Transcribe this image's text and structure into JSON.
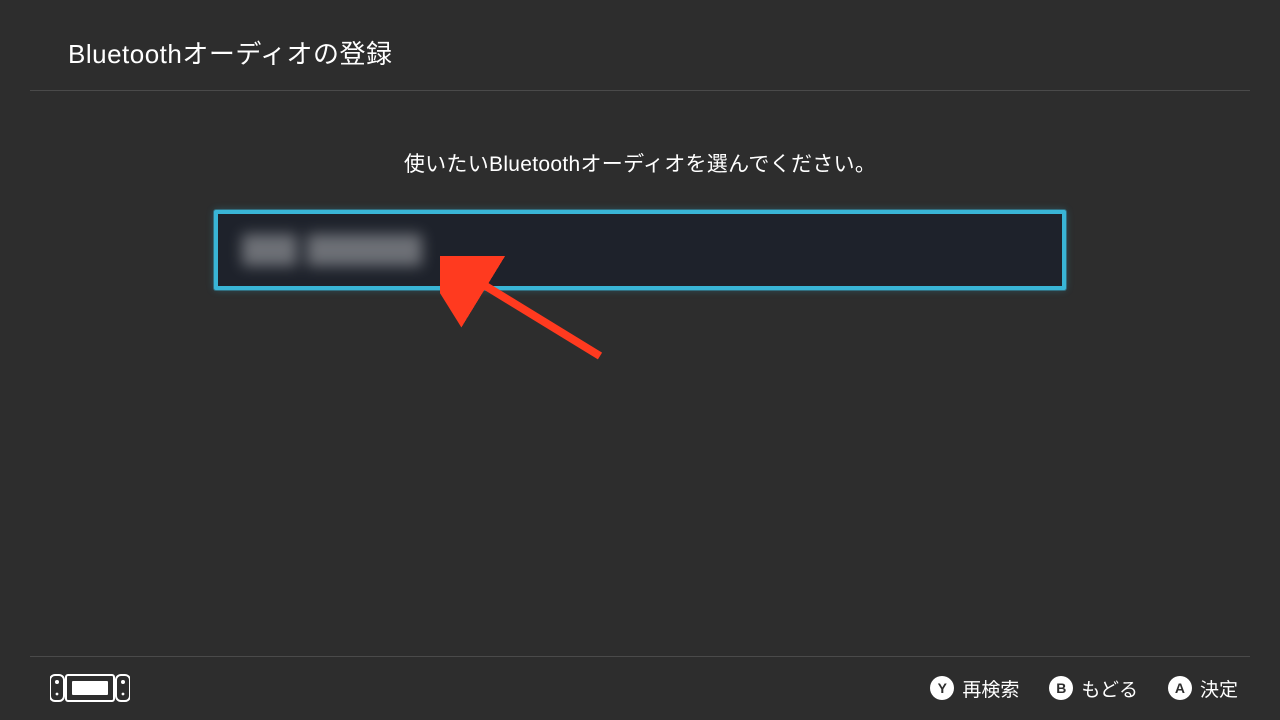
{
  "header": {
    "title": "Bluetoothオーディオの登録"
  },
  "prompt": "使いたいBluetoothオーディオを選んでください。",
  "devices": [
    {
      "name_obscured": true
    }
  ],
  "footer": {
    "y": {
      "btn": "Y",
      "label": "再検索"
    },
    "b": {
      "btn": "B",
      "label": "もどる"
    },
    "a": {
      "btn": "A",
      "label": "決定"
    }
  },
  "colors": {
    "background": "#2d2d2d",
    "item_bg": "#1e222b",
    "highlight": "#39b5d6",
    "divider": "#4a4a4a",
    "arrow": "#ff3a1f"
  }
}
